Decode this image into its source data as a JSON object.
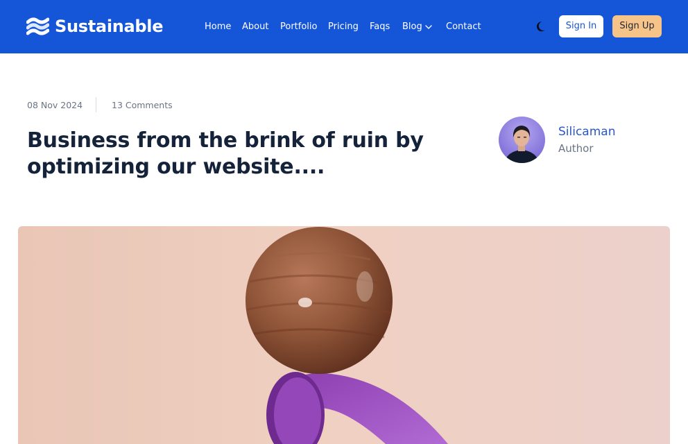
{
  "brand": {
    "name": "Sustainable",
    "logo_icon": "wave-stripes-icon"
  },
  "nav": {
    "items": [
      {
        "label": "Home"
      },
      {
        "label": "About"
      },
      {
        "label": "Portfolio"
      },
      {
        "label": "Pricing"
      },
      {
        "label": "Faqs"
      },
      {
        "label": "Blog",
        "has_dropdown": true
      },
      {
        "label": "Contact"
      }
    ]
  },
  "header": {
    "theme_toggle_icon": "moon-icon",
    "signin_label": "Sign In",
    "signup_label": "Sign Up"
  },
  "post": {
    "date": "08 Nov 2024",
    "comments": "13 Comments",
    "title": "Business from the brink of ruin by optimizing our website....",
    "author": {
      "name": "Silicaman",
      "role": "Author"
    }
  },
  "colors": {
    "header_bg": "#1556d9",
    "signup_bg": "#f6c489",
    "title_color": "#14223a",
    "author_name_color": "#2a56c9"
  }
}
